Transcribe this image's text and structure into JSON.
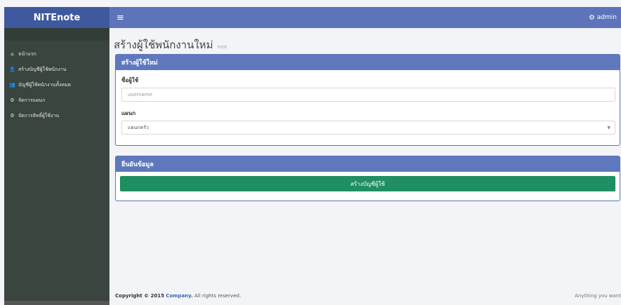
{
  "header": {
    "logo": "NITEnote",
    "menu_icon": "hamburger-icon",
    "user_icon": "gear-icon",
    "user": "admin"
  },
  "sidebar": {
    "items": [
      {
        "label": "หน้าแรก",
        "icon": "home-icon"
      },
      {
        "label": "สร้างบัญชีผู้ใช้พนักงาน",
        "icon": "add-user-icon"
      },
      {
        "label": "บัญชีผู้ใช้พนักงานทั้งหมด",
        "icon": "users-icon"
      },
      {
        "label": "จัดการแผนก",
        "icon": "gears-icon"
      },
      {
        "label": "จัดการสิทธิ์ผู้ใช้งาน",
        "icon": "gears-icon"
      }
    ]
  },
  "page": {
    "title": "สร้างผู้ใช้พนักงานใหม่",
    "subtitle": "root"
  },
  "form": {
    "heading": "สร้างผู้ใช้ใหม่",
    "username_label": "ชื่อผู้ใช้",
    "username_placeholder": "username",
    "department_label": "แผนก",
    "department_selected": "แผนกครัว"
  },
  "confirm": {
    "heading": "ยืนยันข้อมูล",
    "button_label": "สร้างบัญชีผู้ใช้"
  },
  "footer": {
    "copyright_prefix": "Copyright © 2015",
    "company": "Company.",
    "rights": "All rights reserved.",
    "right_text": "Anything you want"
  },
  "colors": {
    "topbar": "#5d74bb",
    "logo_bg": "#3f599e",
    "sidebar": "#3a4540",
    "panel_head": "#5f78bd",
    "button": "#1f8f63"
  }
}
